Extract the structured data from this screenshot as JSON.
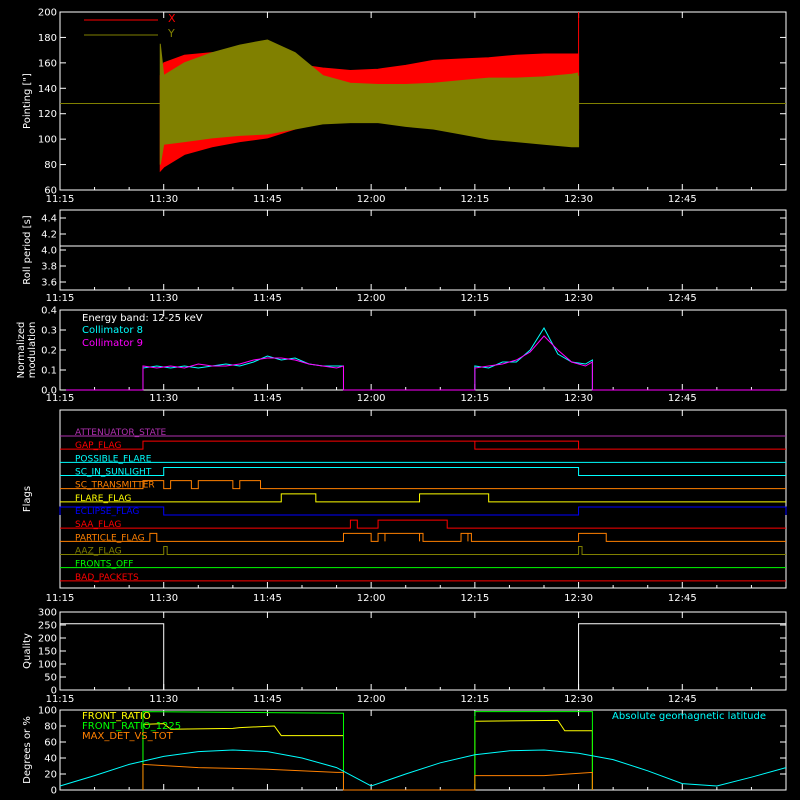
{
  "time_axis": {
    "ticks": [
      "11:15",
      "11:30",
      "11:45",
      "12:00",
      "12:15",
      "12:30",
      "12:45"
    ],
    "tick_minutes": [
      675,
      690,
      705,
      720,
      735,
      750,
      765
    ],
    "range_minutes": [
      675,
      780
    ]
  },
  "colors": {
    "background": "#000000",
    "axes": "#ffffff",
    "x_red": "#ff0000",
    "y_olive": "#808000",
    "roll": "#ffffff",
    "cyan": "#00ffff",
    "magenta": "#ff00ff",
    "purple": "#b030b0",
    "orange": "#ff8000",
    "yellow": "#ffff00",
    "blue": "#0000ff",
    "green": "#00ff00",
    "lightgreen": "#90ee90"
  },
  "chart_data": [
    {
      "id": "pointing",
      "type": "area",
      "ylabel": "Pointing [\"]",
      "ylim": [
        60,
        200
      ],
      "yticks": [
        60,
        80,
        100,
        120,
        140,
        160,
        180,
        200
      ],
      "legend": [
        "X",
        "Y"
      ],
      "legend_position": "top-left",
      "series": [
        {
          "name": "X",
          "color": "#ff0000",
          "upper_x": [
            689.5,
            690,
            693,
            697,
            701,
            705,
            709,
            713,
            717,
            721,
            725,
            729,
            733,
            737,
            741,
            745,
            749,
            750
          ],
          "upper_y": [
            150,
            160,
            166,
            168,
            167,
            163,
            159,
            156,
            154,
            155,
            158,
            162,
            163,
            164,
            166,
            167,
            167,
            167
          ],
          "lower_x": [
            689.5,
            690,
            693,
            697,
            701,
            705,
            709,
            713,
            717,
            721,
            725,
            729,
            733,
            737,
            741,
            745,
            749,
            750
          ],
          "lower_y": [
            75,
            78,
            88,
            94,
            98,
            101,
            108,
            116,
            120,
            121,
            119,
            118,
            117,
            114,
            112,
            110,
            108,
            108
          ]
        },
        {
          "name": "Y",
          "color": "#808000",
          "upper_x": [
            689.5,
            690,
            693,
            697,
            701,
            705,
            709,
            713,
            717,
            721,
            725,
            729,
            733,
            737,
            741,
            745,
            749,
            750
          ],
          "upper_y": [
            175,
            150,
            160,
            168,
            174,
            178,
            168,
            150,
            144,
            143,
            143,
            144,
            146,
            148,
            148,
            149,
            151,
            152
          ],
          "lower_x": [
            689.5,
            690,
            693,
            697,
            701,
            705,
            709,
            713,
            717,
            721,
            725,
            729,
            733,
            737,
            741,
            745,
            749,
            750
          ],
          "lower_y": [
            80,
            96,
            98,
            101,
            103,
            104,
            108,
            112,
            113,
            113,
            110,
            108,
            104,
            100,
            98,
            96,
            94,
            94
          ],
          "baseline": 128
        }
      ]
    },
    {
      "id": "roll",
      "type": "line",
      "ylabel": "Roll period [s]",
      "ylim": [
        3.5,
        4.5
      ],
      "yticks": [
        3.6,
        3.8,
        4.0,
        4.2,
        4.4
      ],
      "series": [
        {
          "name": "",
          "color": "#ffffff",
          "x": [
            675,
            780
          ],
          "y": [
            4.05,
            4.05
          ]
        }
      ]
    },
    {
      "id": "modulation",
      "type": "line",
      "ylabel": "Normalized modulation",
      "ylim": [
        0,
        0.4
      ],
      "yticks": [
        0.0,
        0.1,
        0.2,
        0.3,
        0.4
      ],
      "annotation": "Energy band: 12-25 keV",
      "legend_position": "top-left",
      "series": [
        {
          "name": "Collimator 8",
          "color": "#00ffff",
          "x": [
            675,
            687,
            687,
            689,
            691,
            693,
            695,
            697,
            699,
            701,
            703,
            705,
            707,
            709,
            711,
            713,
            715,
            716,
            716,
            735,
            735,
            737,
            739,
            741,
            743,
            745,
            747,
            749,
            751,
            752,
            752,
            780
          ],
          "y": [
            0,
            0,
            0.11,
            0.12,
            0.11,
            0.12,
            0.11,
            0.12,
            0.13,
            0.12,
            0.14,
            0.17,
            0.15,
            0.16,
            0.13,
            0.12,
            0.12,
            0.12,
            0,
            0,
            0.12,
            0.11,
            0.14,
            0.14,
            0.2,
            0.31,
            0.18,
            0.14,
            0.13,
            0.15,
            0,
            0
          ]
        },
        {
          "name": "Collimator 9",
          "color": "#ff00ff",
          "x": [
            675,
            687,
            687,
            689,
            691,
            693,
            695,
            697,
            699,
            701,
            703,
            705,
            707,
            709,
            711,
            713,
            715,
            716,
            716,
            735,
            735,
            737,
            739,
            741,
            743,
            745,
            747,
            749,
            751,
            752,
            752,
            780
          ],
          "y": [
            0,
            0,
            0.12,
            0.11,
            0.12,
            0.11,
            0.13,
            0.12,
            0.12,
            0.13,
            0.15,
            0.16,
            0.16,
            0.15,
            0.13,
            0.12,
            0.11,
            0.12,
            0,
            0,
            0.11,
            0.12,
            0.13,
            0.15,
            0.19,
            0.27,
            0.2,
            0.14,
            0.12,
            0.14,
            0,
            0
          ]
        }
      ]
    },
    {
      "id": "flags",
      "type": "line",
      "ylabel": "Flags",
      "flags": [
        {
          "name": "ATTENUATOR_STATE",
          "color": "#b030b0",
          "steps": []
        },
        {
          "name": "GAP_FLAG",
          "color": "#ff0000",
          "steps": [
            [
              687,
              750
            ],
            [
              735,
              750
            ]
          ]
        },
        {
          "name": "POSSIBLE_FLARE",
          "color": "#00ffff",
          "steps": []
        },
        {
          "name": "SC_IN_SUNLIGHT",
          "color": "#00ffff",
          "steps": [
            [
              690,
              750
            ]
          ]
        },
        {
          "name": "SC_TRANSMITTER",
          "color": "#ff8000",
          "steps": [
            [
              687,
              690
            ],
            [
              691,
              694
            ],
            [
              695,
              700
            ],
            [
              701,
              704
            ]
          ]
        },
        {
          "name": "FLARE_FLAG",
          "color": "#ffff00",
          "steps": [
            [
              707,
              712
            ],
            [
              727,
              737
            ]
          ]
        },
        {
          "name": "ECLIPSE_FLAG",
          "color": "#0000ff",
          "steps": [
            [
              675,
              690
            ],
            [
              750,
              780
            ]
          ]
        },
        {
          "name": "SAA_FLAG",
          "color": "#ff0000",
          "steps": [
            [
              717,
              718
            ],
            [
              721,
              731
            ]
          ]
        },
        {
          "name": "PARTICLE_FLAG",
          "color": "#ff8000",
          "steps": [
            [
              688,
              689
            ],
            [
              716,
              720
            ],
            [
              721,
              722
            ],
            [
              722,
              727
            ],
            [
              727,
              727.5
            ],
            [
              733,
              734
            ],
            [
              734,
              734.5
            ],
            [
              750,
              754
            ]
          ]
        },
        {
          "name": "AAZ_FLAG",
          "color": "#808000",
          "steps": [
            [
              690,
              690.5
            ],
            [
              750,
              750.5
            ]
          ]
        },
        {
          "name": "FRONTS_OFF",
          "color": "#00ff00",
          "steps": []
        },
        {
          "name": "BAD_PACKETS",
          "color": "#ff0000",
          "steps": []
        }
      ]
    },
    {
      "id": "quality",
      "type": "line",
      "ylabel": "Quality",
      "ylim": [
        0,
        300
      ],
      "yticks": [
        0,
        50,
        100,
        150,
        200,
        250,
        300
      ],
      "series": [
        {
          "name": "",
          "color": "#ffffff",
          "x": [
            675,
            690,
            690,
            750,
            750,
            780
          ],
          "y": [
            255,
            255,
            0,
            0,
            255,
            255
          ]
        }
      ]
    },
    {
      "id": "ratios",
      "type": "line",
      "ylabel": "Degrees or %",
      "ylim": [
        0,
        100
      ],
      "yticks": [
        0,
        20,
        40,
        60,
        80,
        100
      ],
      "legend_position": "top-left",
      "series": [
        {
          "name": "FRONT_RATIO",
          "color": "#ffff00",
          "x": [
            687,
            687,
            690,
            691,
            700,
            701,
            706,
            707,
            716,
            716,
            735,
            735,
            747,
            748,
            752,
            752
          ],
          "y": [
            0,
            82,
            83,
            76,
            77,
            78,
            80,
            68,
            68,
            0,
            0,
            86,
            87,
            74,
            74,
            0
          ]
        },
        {
          "name": "FRONT_RATIO_1225",
          "color": "#00ff00",
          "x": [
            687,
            687,
            716,
            716,
            735,
            735,
            752,
            752
          ],
          "y": [
            0,
            98,
            96,
            0,
            0,
            98,
            98,
            0
          ]
        },
        {
          "name": "MAX_DET_VS_TOT",
          "color": "#ff8000",
          "x": [
            687,
            687,
            695,
            705,
            715,
            716,
            716,
            735,
            735,
            745,
            752,
            752
          ],
          "y": [
            0,
            32,
            28,
            26,
            22,
            22,
            0,
            0,
            18,
            18,
            22,
            0
          ]
        },
        {
          "name": "Absolute geomagnetic latitude",
          "color": "#00ffff",
          "x": [
            675,
            680,
            685,
            690,
            695,
            700,
            705,
            710,
            715,
            720,
            725,
            730,
            735,
            740,
            745,
            750,
            755,
            760,
            765,
            770,
            775,
            780
          ],
          "y": [
            5,
            18,
            32,
            42,
            48,
            50,
            48,
            40,
            28,
            5,
            20,
            34,
            44,
            49,
            50,
            46,
            38,
            24,
            8,
            5,
            16,
            28
          ]
        }
      ]
    }
  ]
}
